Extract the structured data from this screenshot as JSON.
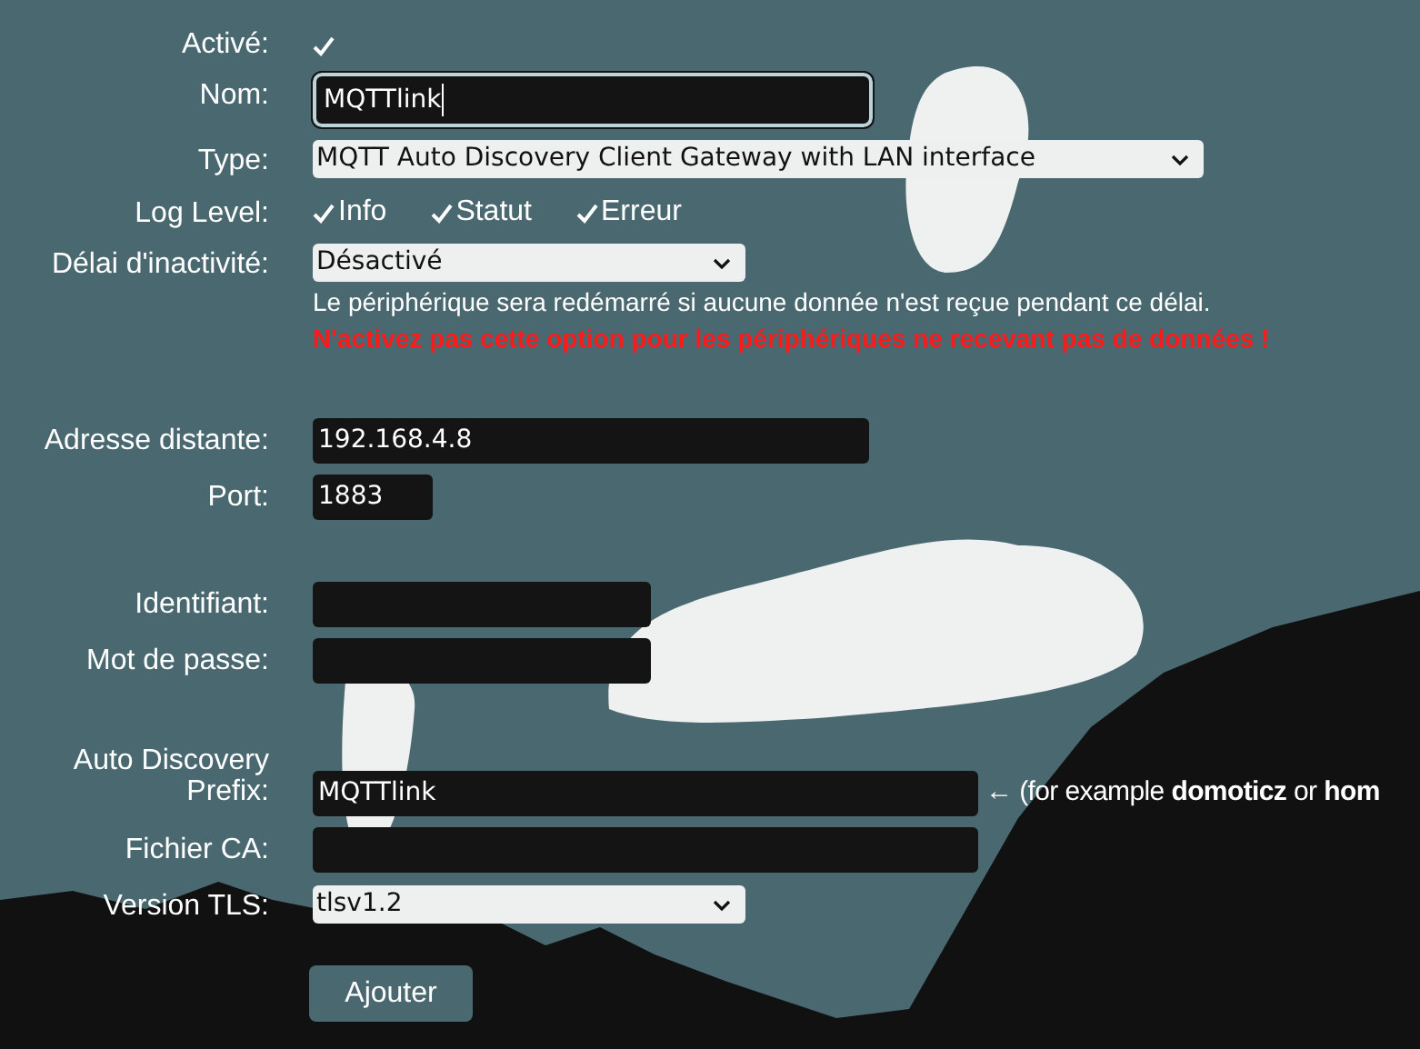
{
  "sections": [
    {
      "fields": [
        {
          "kind": "checkbox",
          "label": "Activé:",
          "checked": true
        },
        {
          "kind": "input",
          "label": "Nom:",
          "value": "MQTTlink",
          "focused": true
        },
        {
          "kind": "select",
          "label": "Type:",
          "value": "MQTT Auto Discovery Client Gateway with LAN interface"
        },
        {
          "kind": "checkboxes",
          "label": "Log Level:",
          "options": [
            {
              "label": "Info",
              "checked": true
            },
            {
              "label": "Statut",
              "checked": true
            },
            {
              "label": "Erreur",
              "checked": true
            }
          ]
        },
        {
          "kind": "select",
          "label": "Délai d'inactivité:",
          "value": "Désactivé",
          "notes": [
            {
              "text": "Le périphérique sera redémarré si aucune donnée n'est reçue pendant ce délai.",
              "warning": false
            },
            {
              "text": "N'activez pas cette option pour les périphériques ne recevant pas de données !",
              "warning": true
            }
          ]
        }
      ]
    },
    {
      "fields": [
        {
          "kind": "input",
          "label": "Adresse distante:",
          "value": "192.168.4.8"
        },
        {
          "kind": "input",
          "label": "Port:",
          "value": "1883"
        }
      ]
    },
    {
      "fields": [
        {
          "kind": "input",
          "label": "Identifiant:"
        },
        {
          "kind": "password",
          "label": "Mot de passe:"
        }
      ]
    },
    {
      "fields": [
        {
          "kind": "input",
          "label": "Auto Discovery Prefix:",
          "value": "MQTTlink",
          "hint": "← (for example **domoticz** or **hom**"
        },
        {
          "kind": "input",
          "label": "Fichier CA:"
        },
        {
          "kind": "select",
          "label": "Version TLS:",
          "value": "tlsv1.2"
        }
      ]
    }
  ],
  "button": "Ajouter"
}
